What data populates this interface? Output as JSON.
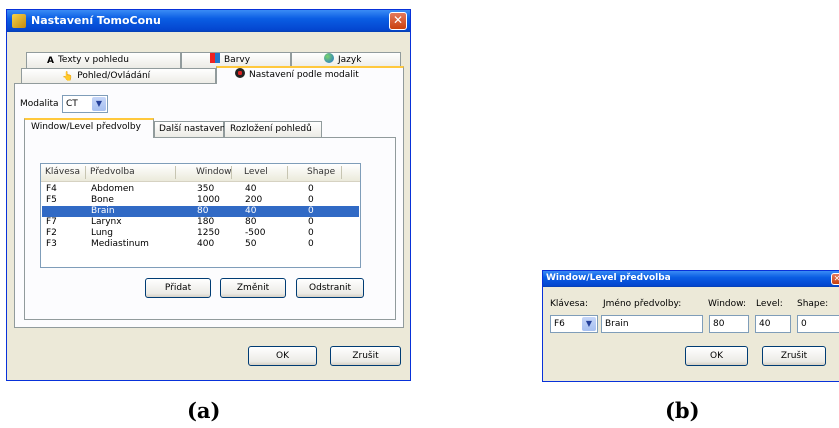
{
  "window_a": {
    "title": "Nastavení TomoConu",
    "tabs_row1": [
      "Texty v pohledu",
      "Barvy",
      "Jazyk"
    ],
    "tabs_row2": [
      "Pohled/Ovládání",
      "Nastavení podle modalit"
    ],
    "modality_label": "Modalita",
    "modality_value": "CT",
    "subtabs": [
      "Window/Level předvolby",
      "Další nastavení",
      "Rozložení pohledů"
    ],
    "columns": [
      "Klávesa",
      "Předvolba",
      "Window",
      "Level",
      "Shape"
    ],
    "rows": [
      {
        "key": "F4",
        "preset": "Abdomen",
        "window": "350",
        "level": "40",
        "shape": "0"
      },
      {
        "key": "F5",
        "preset": "Bone",
        "window": "1000",
        "level": "200",
        "shape": "0"
      },
      {
        "key": "",
        "preset": "Brain",
        "window": "80",
        "level": "40",
        "shape": "0",
        "selected": true
      },
      {
        "key": "F7",
        "preset": "Larynx",
        "window": "180",
        "level": "80",
        "shape": "0"
      },
      {
        "key": "F2",
        "preset": "Lung",
        "window": "1250",
        "level": "-500",
        "shape": "0"
      },
      {
        "key": "F3",
        "preset": "Mediastinum",
        "window": "400",
        "level": "50",
        "shape": "0"
      }
    ],
    "buttons": {
      "add": "Přidat",
      "change": "Změnit",
      "remove": "Odstranit",
      "ok": "OK",
      "cancel": "Zrušit"
    }
  },
  "window_b": {
    "title": "Window/Level předvolba",
    "labels": {
      "key": "Klávesa:",
      "name": "Jméno předvolby:",
      "window": "Window:",
      "level": "Level:",
      "shape": "Shape:"
    },
    "values": {
      "key": "F6",
      "name": "Brain",
      "window": "80",
      "level": "40",
      "shape": "0"
    },
    "buttons": {
      "ok": "OK",
      "cancel": "Zrušit"
    }
  },
  "captions": {
    "a": "(a)",
    "b": "(b)"
  },
  "colors": {
    "titlebar": "#0a5de3",
    "selection": "#316ac5",
    "tab_highlight": "#ffc83c",
    "dialog_bg": "#ece9d8"
  }
}
